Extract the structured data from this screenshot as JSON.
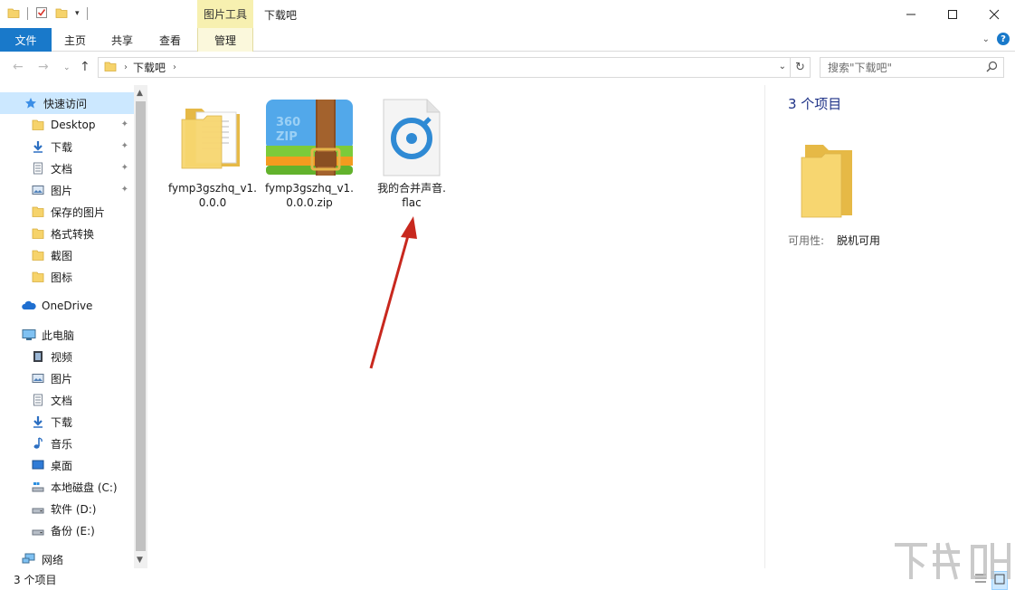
{
  "window": {
    "context_tab": "图片工具",
    "title": "下载吧"
  },
  "ribbon": {
    "tabs": [
      "文件",
      "主页",
      "共享",
      "查看",
      "管理"
    ]
  },
  "address": {
    "crumb": "下载吧",
    "search_placeholder": "搜索\"下载吧\""
  },
  "sidebar": {
    "quick_access": "快速访问",
    "quick_items": [
      "Desktop",
      "下载",
      "文档",
      "图片",
      "保存的图片",
      "格式转换",
      "截图",
      "图标"
    ],
    "onedrive": "OneDrive",
    "this_pc": "此电脑",
    "pc_items": [
      "视频",
      "图片",
      "文档",
      "下载",
      "音乐",
      "桌面",
      "本地磁盘 (C:)",
      "软件 (D:)",
      "备份 (E:)"
    ],
    "network": "网络"
  },
  "files": [
    {
      "name_line1": "fymp3gszhq_v1.",
      "name_line2": "0.0.0",
      "icon": "folder-icon"
    },
    {
      "name_line1": "fymp3gszhq_v1.",
      "name_line2": "0.0.0.zip",
      "icon": "zip-archive-icon"
    },
    {
      "name_line1": "我的合并声音.",
      "name_line2": "flac",
      "icon": "audio-file-icon"
    }
  ],
  "details": {
    "count": "3 个项目",
    "availability_label": "可用性:",
    "availability_value": "脱机可用"
  },
  "status": {
    "text": "3 个项目"
  },
  "colors": {
    "accent": "#1979ca",
    "selected": "#cce8ff",
    "context_tab": "#f7f0b0",
    "annotation_arrow": "#c8281e"
  }
}
